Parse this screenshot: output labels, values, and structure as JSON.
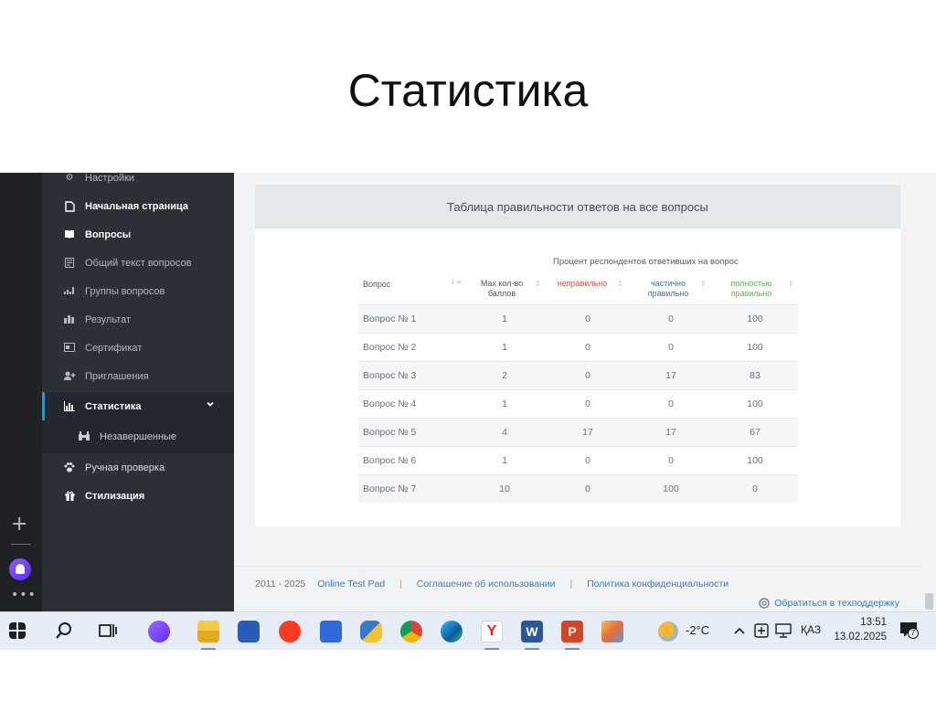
{
  "slide": {
    "title": "Статистика"
  },
  "sidebar": {
    "items": [
      {
        "label": "Настройки",
        "icon": "gear-icon"
      },
      {
        "label": "Начальная страница",
        "icon": "document-icon"
      },
      {
        "label": "Вопросы",
        "icon": "book-icon"
      },
      {
        "label": "Общий текст вопросов",
        "icon": "text-icon"
      },
      {
        "label": "Группы вопросов",
        "icon": "groups-icon"
      },
      {
        "label": "Результат",
        "icon": "bar-chart-icon"
      },
      {
        "label": "Сертификат",
        "icon": "certificate-icon"
      },
      {
        "label": "Приглашения",
        "icon": "add-user-icon"
      },
      {
        "label": "Статистика",
        "icon": "statistics-icon"
      },
      {
        "label": "Незавершенные",
        "icon": "binoculars-icon"
      },
      {
        "label": "Ручная проверка",
        "icon": "paw-icon"
      },
      {
        "label": "Стилизация",
        "icon": "gift-icon"
      }
    ]
  },
  "card": {
    "title": "Таблица правильности ответов на все вопросы",
    "subheader": "Процент респондентов ответивших на вопрос",
    "columns": {
      "question": "Вопрос",
      "max_line1": "Max кол-во",
      "max_line2": "баллов",
      "wrong": "неправильно",
      "partial_line1": "частично",
      "partial_line2": "правильно",
      "full_line1": "полностью",
      "full_line2": "правильно"
    },
    "rows": [
      {
        "q": "Вопрос № 1",
        "max": "1",
        "wrong": "0",
        "partial": "0",
        "full": "100"
      },
      {
        "q": "Вопрос № 2",
        "max": "1",
        "wrong": "0",
        "partial": "0",
        "full": "100"
      },
      {
        "q": "Вопрос № 3",
        "max": "2",
        "wrong": "0",
        "partial": "17",
        "full": "83"
      },
      {
        "q": "Вопрос № 4",
        "max": "1",
        "wrong": "0",
        "partial": "0",
        "full": "100"
      },
      {
        "q": "Вопрос № 5",
        "max": "4",
        "wrong": "17",
        "partial": "17",
        "full": "67"
      },
      {
        "q": "Вопрос № 6",
        "max": "1",
        "wrong": "0",
        "partial": "0",
        "full": "100"
      },
      {
        "q": "Вопрос № 7",
        "max": "10",
        "wrong": "0",
        "partial": "100",
        "full": "0"
      }
    ]
  },
  "footer": {
    "years": "2011 - 2025",
    "brand": "Online Test Pad",
    "sep": "|",
    "terms": "Соглашение об использовании",
    "privacy": "Политика конфиденциальности",
    "support": "Обратиться в техподдержку"
  },
  "taskbar": {
    "weather": "-2°C",
    "lang": "ҚАЗ",
    "time": "13:51",
    "date": "13.02.2025",
    "notifications": "7"
  },
  "colors": {
    "sidebar_bg": "#2b3036",
    "accent_blue": "#3c8dbc",
    "wrong_red": "#d9534f",
    "partial_blue": "#3c6fb5",
    "full_green": "#5cb85c"
  }
}
